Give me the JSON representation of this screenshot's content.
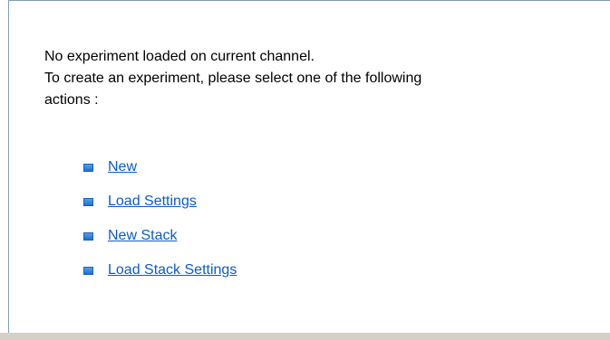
{
  "message": {
    "line1": "No experiment loaded on current channel.",
    "line2": "To create an experiment, please select one of the following",
    "line3": "actions :"
  },
  "actions": [
    {
      "label": "New",
      "icon": "bullet-square-icon"
    },
    {
      "label": "Load Settings",
      "icon": "bullet-square-icon"
    },
    {
      "label": "New Stack",
      "icon": "bullet-square-icon"
    },
    {
      "label": "Load Stack Settings",
      "icon": "bullet-square-icon"
    }
  ],
  "colors": {
    "link": "#0b5cc8",
    "bullet": "#2a86e0",
    "border": "#7f9db9"
  }
}
